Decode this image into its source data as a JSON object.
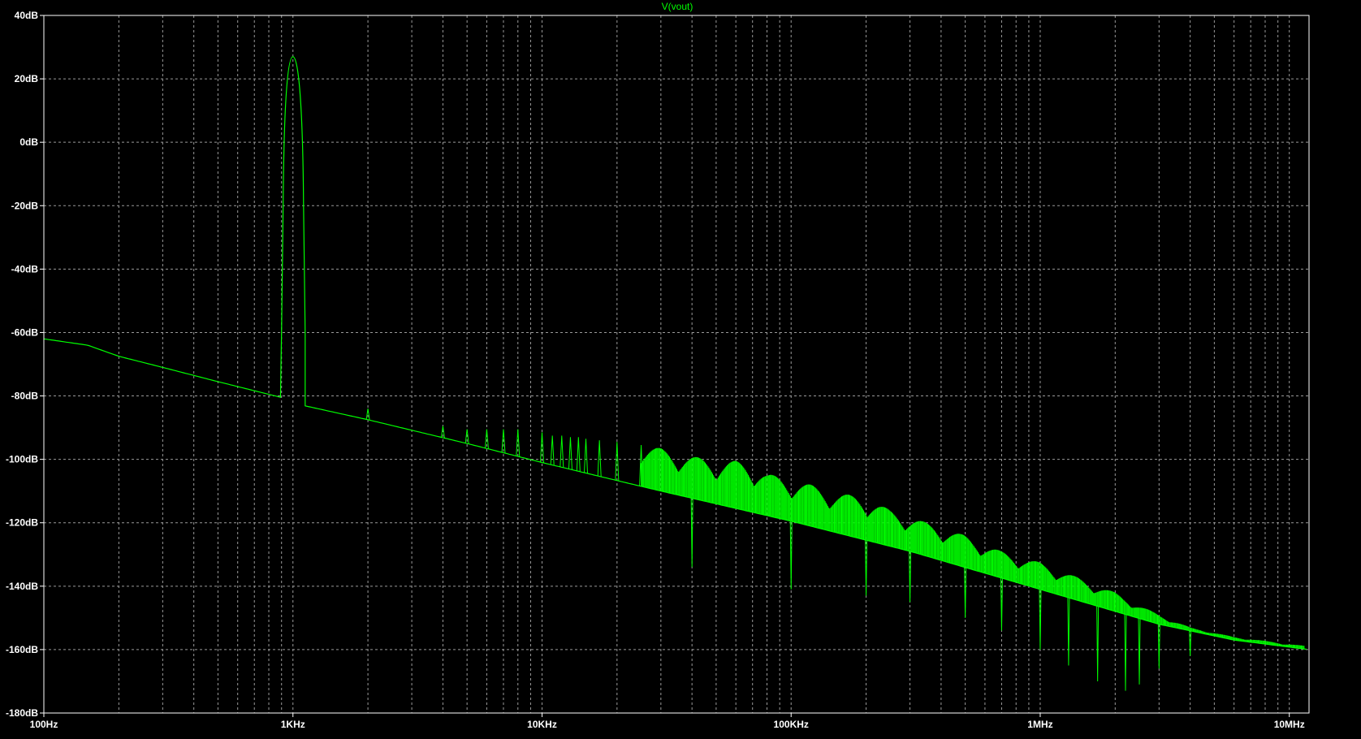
{
  "chart_data": {
    "type": "line",
    "title": "V(vout)",
    "xscale": "log",
    "xlim": [
      100,
      12000000
    ],
    "ylim": [
      -180,
      40
    ],
    "grid": true,
    "colors": {
      "background": "#000000",
      "grid": "#9a9a9a",
      "frame": "#ffffff",
      "trace": "#00ff00",
      "title": "#00ff00",
      "ticklabel": "#ffffff"
    },
    "yticks": [
      {
        "value": 40,
        "label": "40dB"
      },
      {
        "value": 20,
        "label": "20dB"
      },
      {
        "value": 0,
        "label": "0dB"
      },
      {
        "value": -20,
        "label": "-20dB"
      },
      {
        "value": -40,
        "label": "-40dB"
      },
      {
        "value": -60,
        "label": "-60dB"
      },
      {
        "value": -80,
        "label": "-80dB"
      },
      {
        "value": -100,
        "label": "-100dB"
      },
      {
        "value": -120,
        "label": "-120dB"
      },
      {
        "value": -140,
        "label": "-140dB"
      },
      {
        "value": -160,
        "label": "-160dB"
      },
      {
        "value": -180,
        "label": "-180dB"
      }
    ],
    "xticks": [
      {
        "value": 100,
        "label": "100Hz"
      },
      {
        "value": 1000,
        "label": "1KHz"
      },
      {
        "value": 10000,
        "label": "10KHz"
      },
      {
        "value": 100000,
        "label": "100KHz"
      },
      {
        "value": 1000000,
        "label": "1MHz"
      },
      {
        "value": 10000000,
        "label": "10MHz"
      }
    ],
    "series": [
      {
        "name": "V(vout)",
        "baseline": [
          [
            100,
            -62
          ],
          [
            150,
            -64
          ],
          [
            200,
            -67.5
          ],
          [
            300,
            -71
          ],
          [
            500,
            -75.5
          ],
          [
            900,
            -80.5
          ],
          [
            1100,
            -83
          ],
          [
            2000,
            -87.5
          ],
          [
            5000,
            -95
          ],
          [
            10000,
            -101
          ],
          [
            30000,
            -110
          ],
          [
            100000,
            -119.5
          ],
          [
            300000,
            -129
          ],
          [
            1000000,
            -141
          ],
          [
            3000000,
            -152
          ],
          [
            6000000,
            -157
          ],
          [
            12000000,
            -160
          ]
        ],
        "carrier_peak": {
          "freq": 1000,
          "level": 27,
          "edge_low": 900,
          "edge_high": 1120
        },
        "harmonic_peaks": [
          [
            2000,
            -84
          ],
          [
            4000,
            -89.5
          ],
          [
            5000,
            -90.5
          ],
          [
            6000,
            -90.5
          ],
          [
            7000,
            -90.5
          ],
          [
            8000,
            -90.5
          ],
          [
            10000,
            -91.5
          ],
          [
            11000,
            -92.5
          ],
          [
            12000,
            -92.5
          ],
          [
            13000,
            -93
          ],
          [
            14000,
            -93
          ],
          [
            15000,
            -93.5
          ],
          [
            17000,
            -94
          ],
          [
            20000,
            -94.5
          ],
          [
            25000,
            -95.5
          ],
          [
            30000,
            -96.5
          ],
          [
            35000,
            -98
          ],
          [
            40000,
            -99
          ],
          [
            50000,
            -100.5
          ],
          [
            60000,
            -100.5
          ],
          [
            70000,
            -101.5
          ],
          [
            80000,
            -104.5
          ],
          [
            100000,
            -106.5
          ],
          [
            120000,
            -108
          ],
          [
            150000,
            -110.5
          ],
          [
            200000,
            -112
          ],
          [
            250000,
            -116
          ],
          [
            300000,
            -118
          ],
          [
            350000,
            -120
          ],
          [
            400000,
            -121.5
          ],
          [
            500000,
            -124
          ],
          [
            600000,
            -127
          ],
          [
            700000,
            -129
          ],
          [
            800000,
            -130.5
          ],
          [
            1000000,
            -132.5
          ],
          [
            1200000,
            -135
          ],
          [
            1500000,
            -138
          ],
          [
            2000000,
            -142
          ],
          [
            2500000,
            -146
          ],
          [
            3000000,
            -149
          ],
          [
            4000000,
            -153
          ],
          [
            5000000,
            -155.5
          ],
          [
            6000000,
            -157
          ],
          [
            8000000,
            -158.5
          ],
          [
            10000000,
            -159.5
          ]
        ],
        "notches": [
          [
            40000,
            -134
          ],
          [
            100000,
            -141
          ],
          [
            200000,
            -143
          ],
          [
            300000,
            -145
          ],
          [
            500000,
            -150
          ],
          [
            700000,
            -154
          ],
          [
            1000000,
            -160
          ],
          [
            1300000,
            -165
          ],
          [
            1700000,
            -170
          ],
          [
            2200000,
            -173
          ],
          [
            2500000,
            -171
          ],
          [
            3000000,
            -166
          ],
          [
            4000000,
            -162
          ]
        ]
      }
    ]
  }
}
